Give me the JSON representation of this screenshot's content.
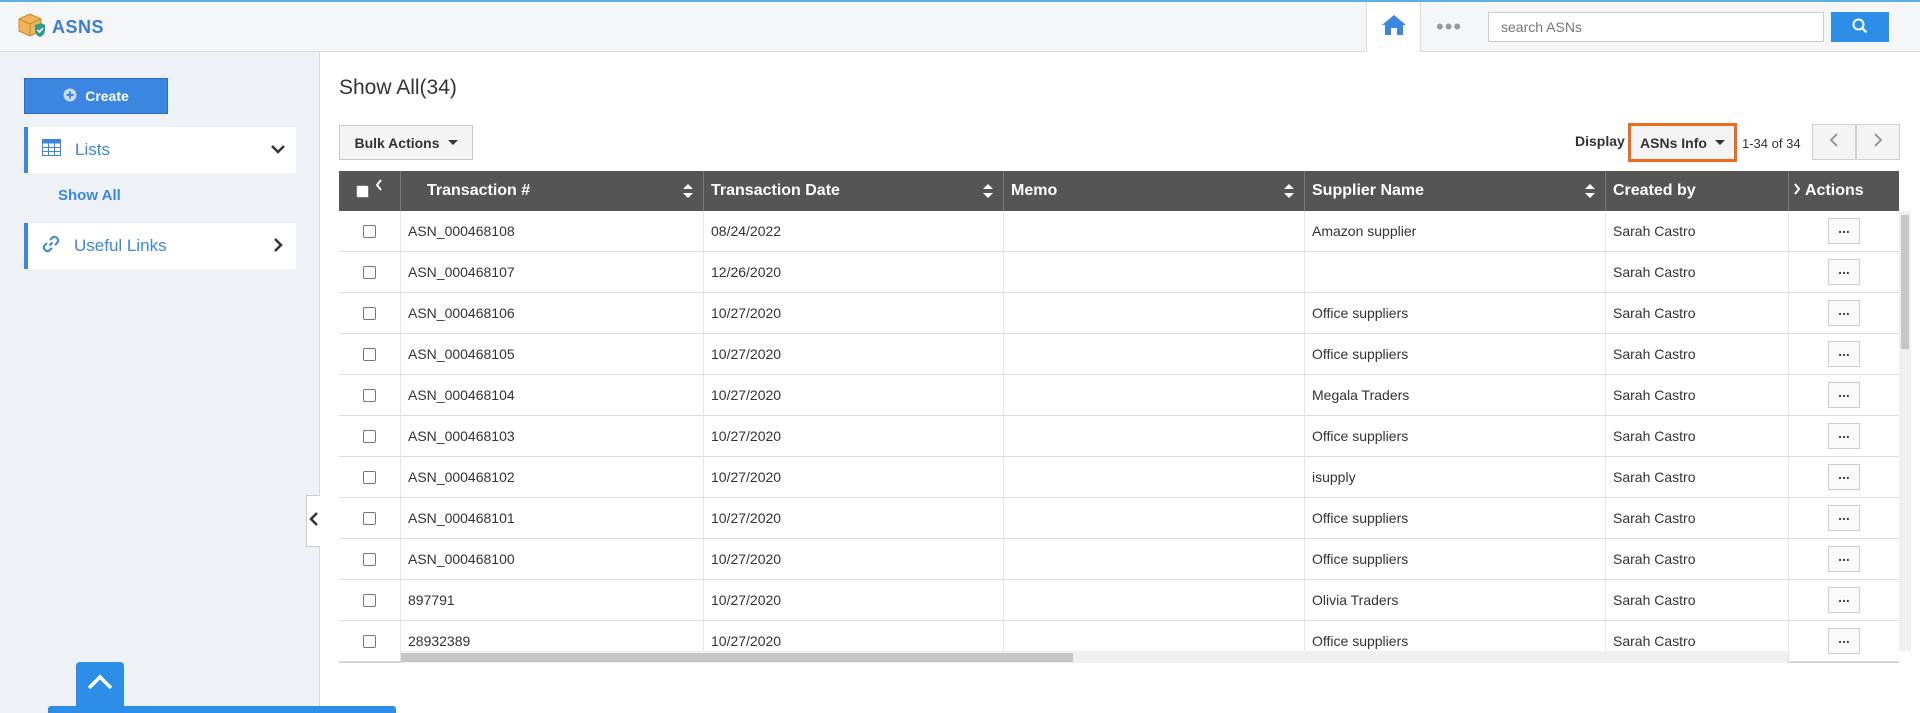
{
  "app": {
    "title": "ASNS"
  },
  "header": {
    "search_placeholder": "search ASNs",
    "home_icon": "home-icon",
    "more_icon": "more-dots-icon",
    "search_icon": "search-icon"
  },
  "sidebar": {
    "create_label": "Create",
    "items": [
      {
        "label": "Lists",
        "icon": "table-icon",
        "chevron": "chevron-down-icon"
      },
      {
        "label": "Useful Links",
        "icon": "link-icon",
        "chevron": "chevron-right-icon"
      }
    ],
    "sub_item": "Show All"
  },
  "main": {
    "title": "Show All(34)",
    "bulk_actions_label": "Bulk Actions",
    "display_label": "Display",
    "display_value": "ASNs Info",
    "page_info": "1-34 of 34"
  },
  "table": {
    "columns": [
      "Transaction #",
      "Transaction Date",
      "Memo",
      "Supplier Name",
      "Created by",
      "Actions"
    ],
    "rows": [
      {
        "transaction": "ASN_000468108",
        "date": "08/24/2022",
        "memo": "",
        "supplier": "Amazon supplier",
        "created_by": "Sarah Castro"
      },
      {
        "transaction": "ASN_000468107",
        "date": "12/26/2020",
        "memo": "",
        "supplier": "",
        "created_by": "Sarah Castro"
      },
      {
        "transaction": "ASN_000468106",
        "date": "10/27/2020",
        "memo": "",
        "supplier": "Office suppliers",
        "created_by": "Sarah Castro"
      },
      {
        "transaction": "ASN_000468105",
        "date": "10/27/2020",
        "memo": "",
        "supplier": "Office suppliers",
        "created_by": "Sarah Castro"
      },
      {
        "transaction": "ASN_000468104",
        "date": "10/27/2020",
        "memo": "",
        "supplier": "Megala Traders",
        "created_by": "Sarah Castro"
      },
      {
        "transaction": "ASN_000468103",
        "date": "10/27/2020",
        "memo": "",
        "supplier": "Office suppliers",
        "created_by": "Sarah Castro"
      },
      {
        "transaction": "ASN_000468102",
        "date": "10/27/2020",
        "memo": "",
        "supplier": "isupply",
        "created_by": "Sarah Castro"
      },
      {
        "transaction": "ASN_000468101",
        "date": "10/27/2020",
        "memo": "",
        "supplier": "Office suppliers",
        "created_by": "Sarah Castro"
      },
      {
        "transaction": "ASN_000468100",
        "date": "10/27/2020",
        "memo": "",
        "supplier": "Office suppliers",
        "created_by": "Sarah Castro"
      },
      {
        "transaction": "897791",
        "date": "10/27/2020",
        "memo": "",
        "supplier": "Olivia Traders",
        "created_by": "Sarah Castro"
      },
      {
        "transaction": "28932389",
        "date": "10/27/2020",
        "memo": "",
        "supplier": "Office suppliers",
        "created_by": "Sarah Castro"
      }
    ]
  },
  "colors": {
    "accent": "#2d8ee8",
    "highlight": "#f06a1e",
    "header_bg": "#555555"
  }
}
